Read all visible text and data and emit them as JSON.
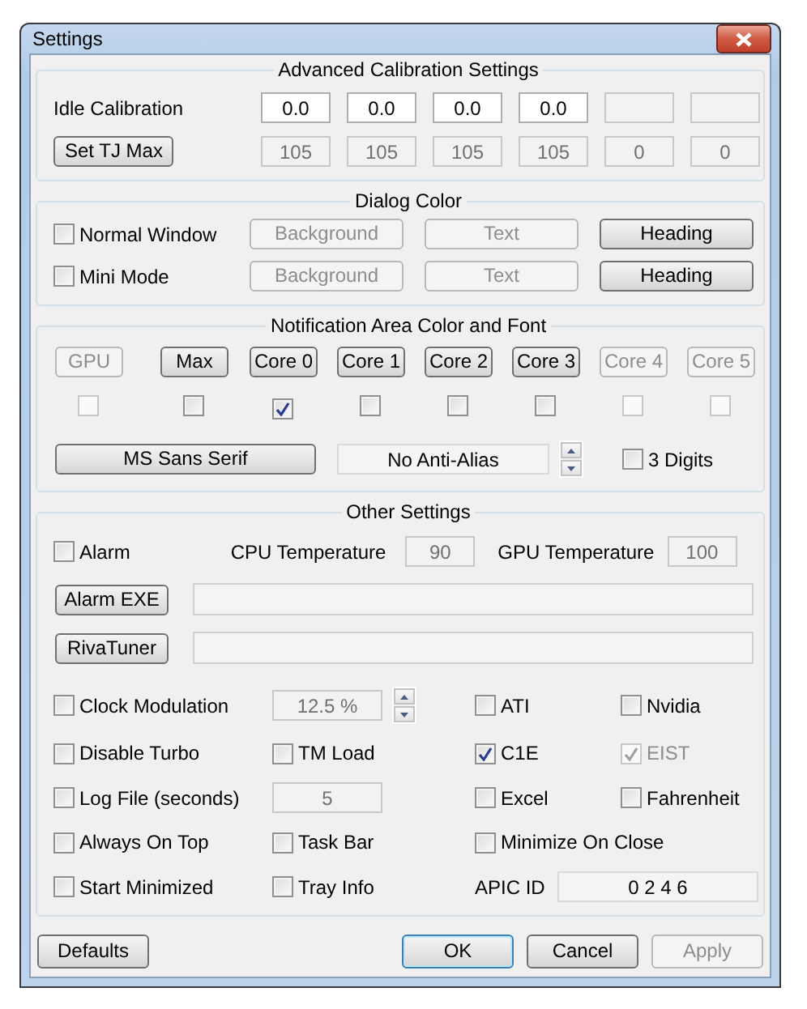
{
  "window": {
    "title": "Settings"
  },
  "calibration": {
    "title": "Advanced Calibration Settings",
    "idle_label": "Idle Calibration",
    "idle_fields": [
      {
        "value": "0.0",
        "disabled": false
      },
      {
        "value": "0.0",
        "disabled": false
      },
      {
        "value": "0.0",
        "disabled": false
      },
      {
        "value": "0.0",
        "disabled": false
      },
      {
        "disabled": true
      },
      {
        "disabled": true
      }
    ],
    "tjmax_button": "Set TJ Max",
    "tjmax_fields": [
      {
        "value": "105",
        "disabled": true
      },
      {
        "value": "105",
        "disabled": true
      },
      {
        "value": "105",
        "disabled": true
      },
      {
        "value": "105",
        "disabled": true
      },
      {
        "value": "0",
        "disabled": true
      },
      {
        "value": "0",
        "disabled": true
      }
    ]
  },
  "dialog_color": {
    "title": "Dialog Color",
    "rows": [
      {
        "label": "Normal Window",
        "checked": false,
        "buttons": [
          {
            "label": "Background",
            "disabled": true
          },
          {
            "label": "Text",
            "disabled": true
          },
          {
            "label": "Heading",
            "disabled": false
          }
        ]
      },
      {
        "label": "Mini Mode",
        "checked": false,
        "buttons": [
          {
            "label": "Background",
            "disabled": true
          },
          {
            "label": "Text",
            "disabled": true
          },
          {
            "label": "Heading",
            "disabled": false
          }
        ]
      }
    ]
  },
  "notification": {
    "title": "Notification Area Color and Font",
    "sources": [
      {
        "label": "GPU",
        "disabled": true,
        "checked": false
      },
      {
        "label": "Max",
        "disabled": false,
        "checked": false
      },
      {
        "label": "Core 0",
        "disabled": false,
        "checked": true
      },
      {
        "label": "Core 1",
        "disabled": false,
        "checked": false
      },
      {
        "label": "Core 2",
        "disabled": false,
        "checked": false
      },
      {
        "label": "Core 3",
        "disabled": false,
        "checked": false
      },
      {
        "label": "Core 4",
        "disabled": true,
        "checked": false
      },
      {
        "label": "Core 5",
        "disabled": true,
        "checked": false
      }
    ],
    "font_button": "MS Sans Serif",
    "alias_field": "No Anti-Alias",
    "three_digits": {
      "label": "3 Digits",
      "checked": false
    }
  },
  "other": {
    "title": "Other Settings",
    "alarm": {
      "label": "Alarm",
      "checked": false
    },
    "cpu_temp": {
      "label": "CPU Temperature",
      "value": "90"
    },
    "gpu_temp": {
      "label": "GPU Temperature",
      "value": "100"
    },
    "path_rows": [
      {
        "button": "Alarm EXE"
      },
      {
        "button": "RivaTuner"
      }
    ],
    "grid": [
      [
        {
          "kind": "checkbox",
          "label": "Clock Modulation",
          "checked": false,
          "disabled": false
        },
        {
          "kind": "spinner",
          "value": "12.5 %"
        },
        {
          "kind": "checkbox",
          "label": "ATI",
          "checked": false,
          "disabled": false
        },
        {
          "kind": "checkbox",
          "label": "Nvidia",
          "checked": false,
          "disabled": false
        }
      ],
      [
        {
          "kind": "checkbox",
          "label": "Disable Turbo",
          "checked": false,
          "disabled": false
        },
        {
          "kind": "checkbox",
          "label": "TM Load",
          "checked": false,
          "disabled": false
        },
        {
          "kind": "checkbox",
          "label": "C1E",
          "checked": true,
          "disabled": false
        },
        {
          "kind": "checkbox",
          "label": "EIST",
          "checked": true,
          "disabled": true
        }
      ],
      [
        {
          "kind": "checkbox",
          "label": "Log File (seconds)",
          "checked": false,
          "disabled": false
        },
        {
          "kind": "field",
          "value": "5"
        },
        {
          "kind": "checkbox",
          "label": "Excel",
          "checked": false,
          "disabled": false
        },
        {
          "kind": "checkbox",
          "label": "Fahrenheit",
          "checked": false,
          "disabled": false
        }
      ],
      [
        {
          "kind": "checkbox",
          "label": "Always On Top",
          "checked": false,
          "disabled": false
        },
        {
          "kind": "checkbox",
          "label": "Task Bar",
          "checked": false,
          "disabled": false
        },
        {
          "kind": "checkbox",
          "label": "Minimize On Close",
          "checked": false,
          "disabled": false
        }
      ],
      [
        {
          "kind": "checkbox",
          "label": "Start Minimized",
          "checked": false,
          "disabled": false
        },
        {
          "kind": "checkbox",
          "label": "Tray Info",
          "checked": false,
          "disabled": false
        },
        {
          "kind": "labeled-field",
          "label": "APIC ID",
          "value": "0 2 4 6"
        }
      ]
    ]
  },
  "footer": {
    "left": [
      {
        "label": "Defaults",
        "disabled": false,
        "default": false
      }
    ],
    "right": [
      {
        "label": "OK",
        "disabled": false,
        "default": true
      },
      {
        "label": "Cancel",
        "disabled": false,
        "default": false
      },
      {
        "label": "Apply",
        "disabled": true,
        "default": false
      }
    ]
  }
}
